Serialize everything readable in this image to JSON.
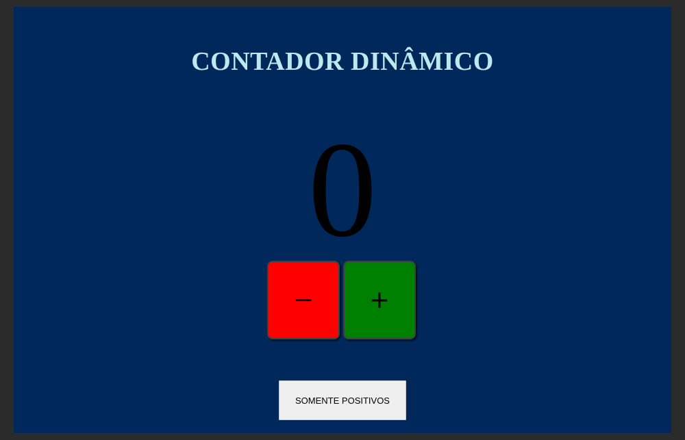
{
  "app": {
    "title": "CONTADOR DINÂMICO"
  },
  "counter": {
    "value": "0"
  },
  "controls": {
    "decrement_symbol": "−",
    "increment_symbol": "+",
    "positive_only_label": "SOMENTE POSITIVOS"
  },
  "colors": {
    "page_background": "#2b2b2b",
    "panel_background": "#00285a",
    "title": "#bfe7ee",
    "decrement_button": "#ff0000",
    "increment_button": "#008000",
    "toggle_button": "#efefef"
  },
  "icons": {
    "decrement": "minus-icon",
    "increment": "plus-icon"
  }
}
